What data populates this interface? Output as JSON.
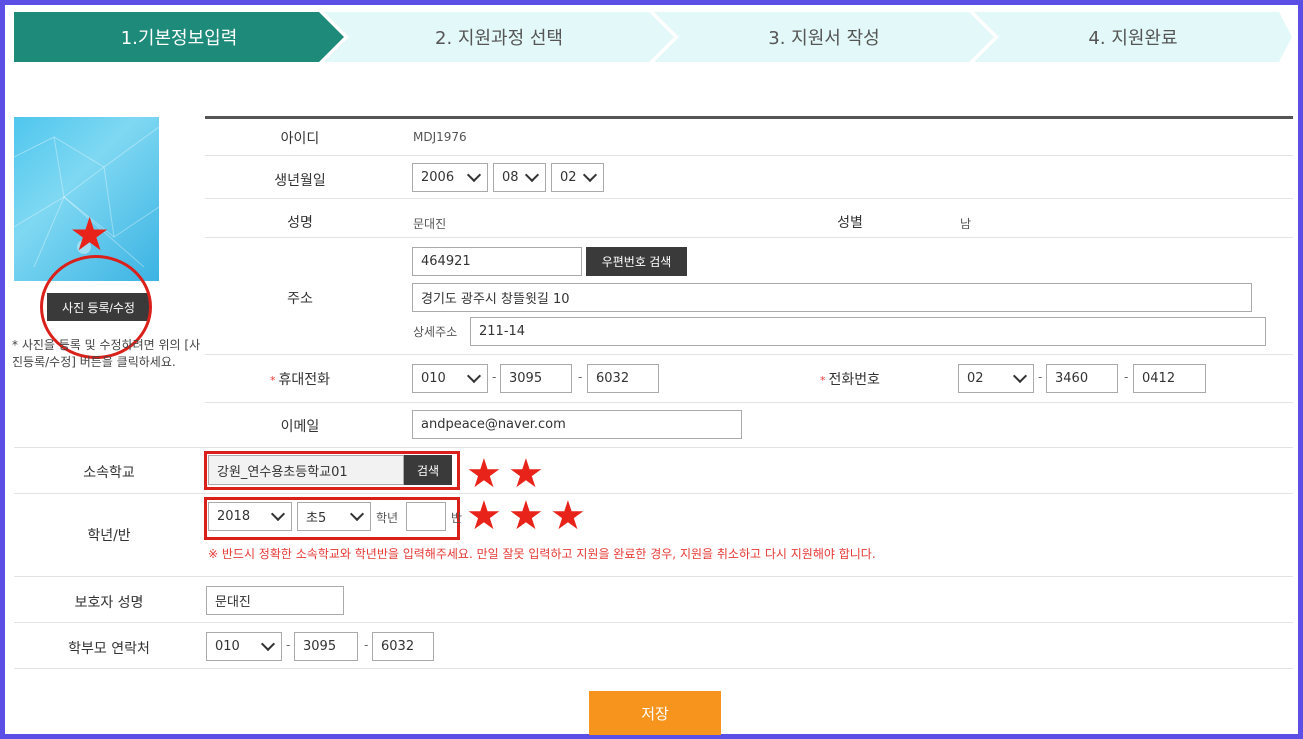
{
  "steps": [
    {
      "label": "1.기본정보입력"
    },
    {
      "label": "2. 지원과정 선택"
    },
    {
      "label": "3. 지원서 작성"
    },
    {
      "label": "4. 지원완료"
    }
  ],
  "photo": {
    "button_label": "사진 등록/수정",
    "note": "* 사진을 등록 및 수정하려면 위의 [사진등록/수정] 버튼을 클릭하세요."
  },
  "form": {
    "id_label": "아이디",
    "id_value": "MDJ1976",
    "birth_label": "생년월일",
    "birth_year": "2006",
    "birth_month": "08",
    "birth_day": "02",
    "name_label": "성명",
    "name_value": "문대진",
    "gender_label": "성별",
    "gender_value": "남",
    "address_label": "주소",
    "zipcode": "464921",
    "zip_search_label": "우편번호 검색",
    "address1": "경기도 광주시 창뜰윗길 10",
    "address_detail_label": "상세주소",
    "address_detail": "211-14",
    "mobile_label": "휴대전화",
    "mobile": [
      "010",
      "3095",
      "6032"
    ],
    "phone_label": "전화번호",
    "phone": [
      "02",
      "3460",
      "0412"
    ],
    "email_label": "이메일",
    "email": "andpeace@naver.com",
    "school_label": "소속학교",
    "school_value": "강원_연수용초등학교01",
    "school_search_label": "검색",
    "grade_label": "학년/반",
    "grade_year": "2018",
    "grade_level": "초5",
    "grade_unit": "학년",
    "class_value": "",
    "class_unit": "반",
    "warning": "※ 반드시 정확한 소속학교와 학년반을 입력해주세요. 만일 잘못 입력하고 지원을 완료한 경우, 지원을 취소하고 다시 지원해야 합니다.",
    "guardian_label": "보호자 성명",
    "guardian_value": "문대진",
    "parent_phone_label": "학부모 연락처",
    "parent_phone": [
      "010",
      "3095",
      "6032"
    ],
    "required_mark": "*"
  },
  "save_label": "저장",
  "colors": {
    "step_active": "#1e8a7a",
    "step_inactive": "#e3f8f8",
    "frame": "#5b4fe6",
    "annotation_red": "#d9201a",
    "save_button": "#f7941d"
  }
}
